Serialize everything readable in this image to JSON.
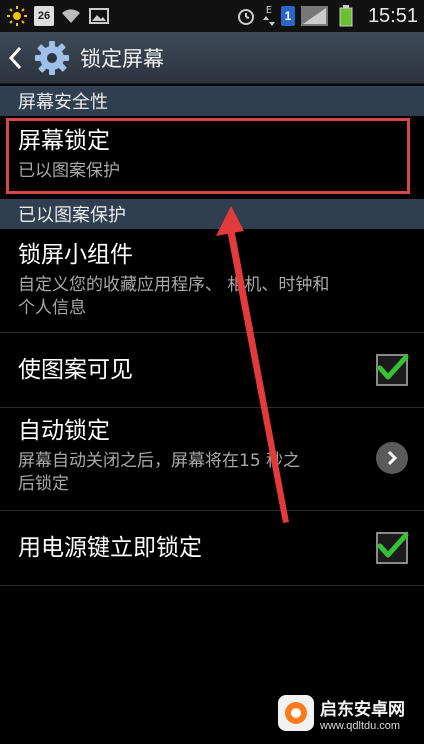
{
  "status_bar": {
    "date_badge": "26",
    "network_label": "E",
    "sim_slot": "1",
    "time": "15:51",
    "icons": [
      "weather-sun-icon",
      "calendar-date-icon",
      "wifi-icon",
      "image-notification-icon",
      "alarm-icon",
      "data-transfer-icon",
      "sim-icon",
      "signal-icon",
      "battery-icon"
    ]
  },
  "header": {
    "title": "锁定屏幕"
  },
  "sections": [
    {
      "header": "屏幕安全性"
    },
    {
      "header": "已以图案保护"
    }
  ],
  "items": [
    {
      "title": "屏幕锁定",
      "subtitle": "已以图案保护"
    },
    {
      "title": "锁屏小组件",
      "subtitle": "自定义您的收藏应用程序、相机、时钟和个人信息",
      "subtitle_line1": "自定义您的收藏应用程序、 相机、时钟和",
      "subtitle_line2": "个人信息"
    },
    {
      "title": "使图案可见",
      "checked": true
    },
    {
      "title": "自动锁定",
      "subtitle_line1": "屏幕自动关闭之后，屏幕将在15 秒之",
      "subtitle_line2": "后锁定"
    },
    {
      "title": "用电源键立即锁定",
      "checked": true
    }
  ],
  "annotation": {
    "box_color": "#d84646",
    "arrow_color": "#e33b3b"
  },
  "watermark": {
    "title": "启东安卓网",
    "url": "www.qdltdu.com"
  },
  "colors": {
    "accent_check": "#35c235",
    "section_bg": "#2f3f50"
  }
}
